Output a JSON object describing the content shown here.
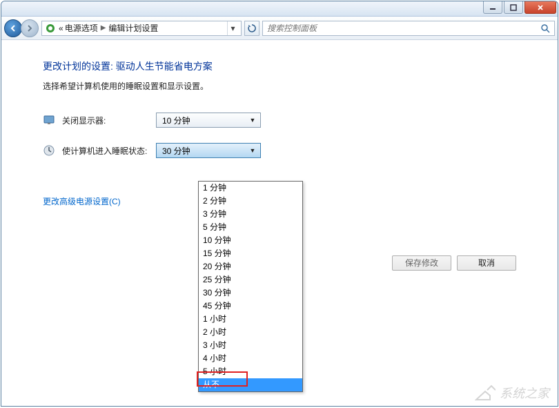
{
  "breadcrumb": {
    "level1_prefix": "«",
    "level1": "电源选项",
    "level2": "编辑计划设置"
  },
  "search": {
    "placeholder": "搜索控制面板"
  },
  "heading": "更改计划的设置: 驱动人生节能省电方案",
  "subtext": "选择希望计算机使用的睡眠设置和显示设置。",
  "display_off": {
    "label": "关闭显示器:",
    "value": "10 分钟"
  },
  "sleep": {
    "label": "使计算机进入睡眠状态:",
    "value": "30 分钟"
  },
  "dropdown_options": [
    "1 分钟",
    "2 分钟",
    "3 分钟",
    "5 分钟",
    "10 分钟",
    "15 分钟",
    "20 分钟",
    "25 分钟",
    "30 分钟",
    "45 分钟",
    "1 小时",
    "2 小时",
    "3 小时",
    "4 小时",
    "5 小时",
    "从不"
  ],
  "dropdown_highlight_index": 15,
  "advanced_link": "更改高级电源设置(C)",
  "buttons": {
    "save": "保存修改",
    "cancel": "取消"
  },
  "watermark": "系统之家"
}
